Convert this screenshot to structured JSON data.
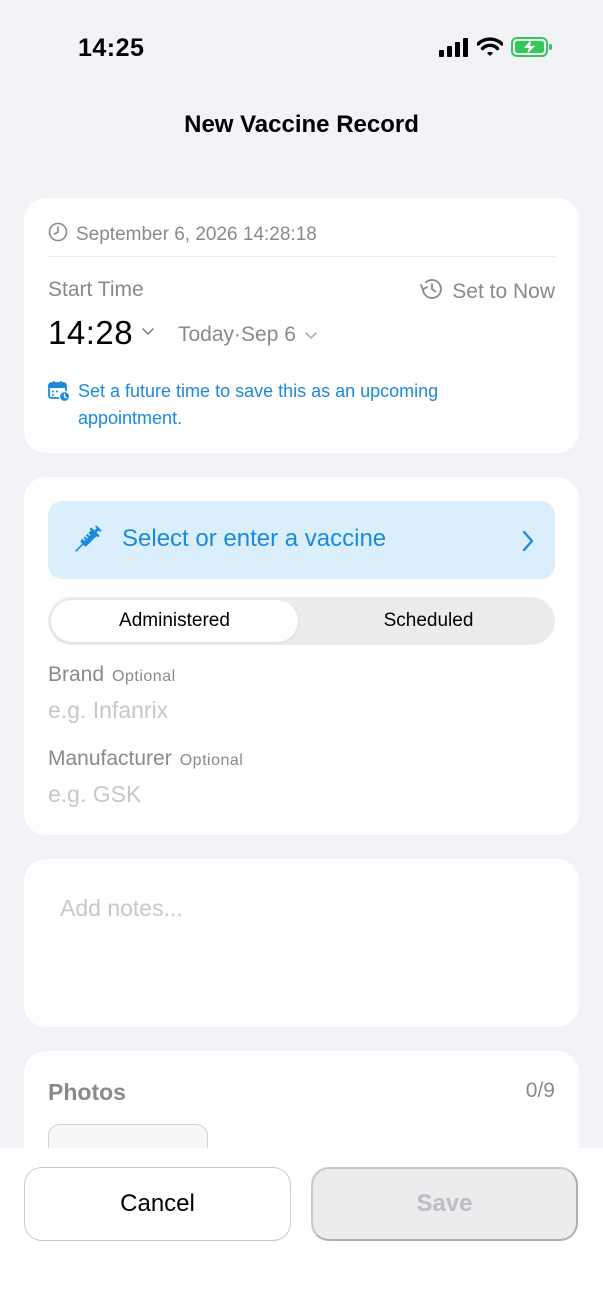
{
  "status_bar": {
    "time": "14:25",
    "icons": [
      "cellular-signal-icon",
      "wifi-icon",
      "battery-charging-icon"
    ],
    "battery_color": "#34c759"
  },
  "nav": {
    "title": "New Vaccine Record"
  },
  "time_card": {
    "timestamp": "September 6, 2026 14:28:18",
    "start_label": "Start Time",
    "set_now_label": "Set to Now",
    "time": "14:28",
    "date": "Today·Sep 6",
    "hint": "Set a future time to save this as an upcoming appointment."
  },
  "vaccine_card": {
    "select_label": "Select or enter a vaccine",
    "segments": [
      "Administered",
      "Scheduled"
    ],
    "selected_segment": "Administered",
    "brand": {
      "label": "Brand",
      "optional": "Optional",
      "placeholder": "e.g. Infanrix",
      "value": ""
    },
    "manufacturer": {
      "label": "Manufacturer",
      "optional": "Optional",
      "placeholder": "e.g. GSK",
      "value": ""
    }
  },
  "notes": {
    "placeholder": "Add notes...",
    "value": ""
  },
  "photos": {
    "title": "Photos",
    "count": "0/9"
  },
  "actions": {
    "cancel_label": "Cancel",
    "save_label": "Save"
  },
  "colors": {
    "accent": "#1a8bdc",
    "accent_bg": "#dbeefb",
    "background": "#f2f2f7",
    "secondary_text": "#8a8a8e",
    "placeholder": "#c7c7cc"
  }
}
